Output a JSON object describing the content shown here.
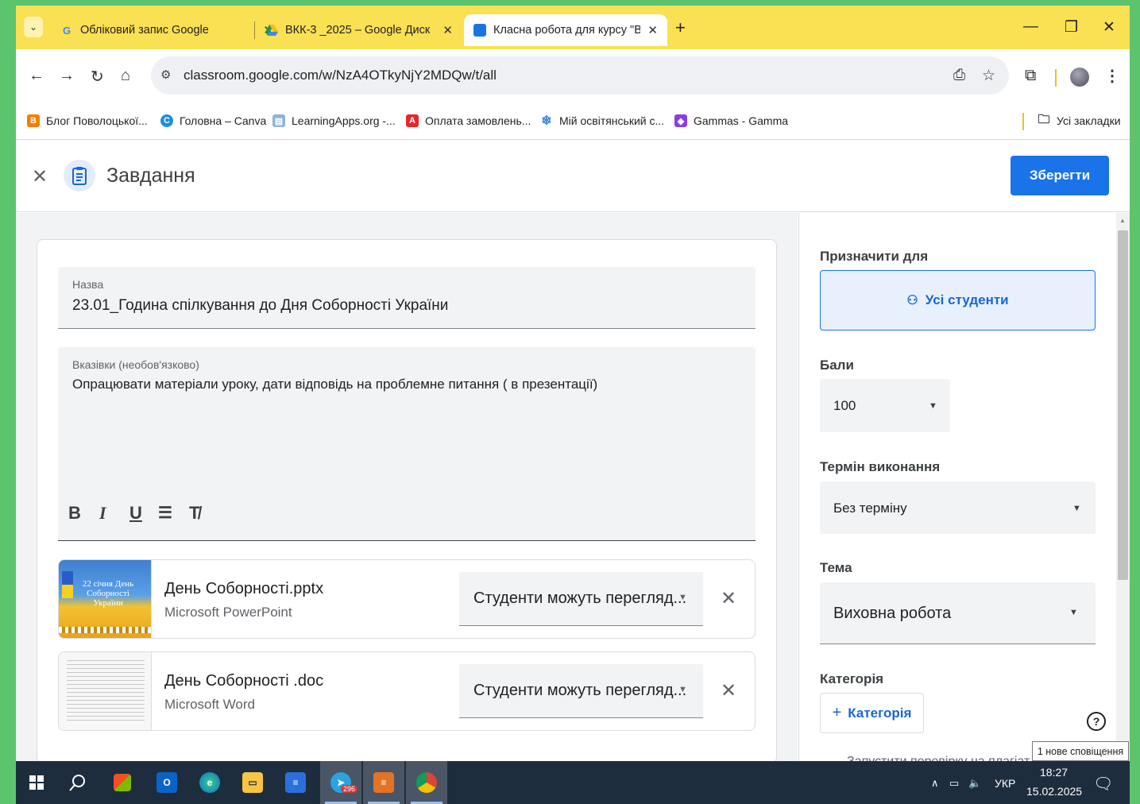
{
  "browser": {
    "tabs": [
      {
        "title": "Обліковий запис Google"
      },
      {
        "title": "ВКК-3 _2025 – Google Диск"
      },
      {
        "title": "Класна робота для курсу \"ВКК"
      }
    ],
    "url": "classroom.google.com/w/NzA4OTkyNjY2MDQw/t/all"
  },
  "bookmarks": {
    "items": [
      {
        "label": "Блог Поволоцької..."
      },
      {
        "label": "Головна – Canva"
      },
      {
        "label": "LearningApps.org -..."
      },
      {
        "label": "Оплата замовлень..."
      },
      {
        "label": "Мій освітянський с..."
      },
      {
        "label": "Gammas - Gamma"
      }
    ],
    "all_bookmarks": "Усі закладки"
  },
  "assignment": {
    "header_title": "Завдання",
    "save_label": "Зберегти",
    "title_label": "Назва",
    "title_value": "23.01_Година спілкування до Дня Соборності України",
    "desc_label": "Вказівки (необов'язково)",
    "desc_value": "Опрацювати матеріали уроку, дати відповідь на проблемне питання ( в презентації)",
    "format": {
      "bold": "B",
      "italic": "I",
      "underline": "U"
    },
    "attachments": [
      {
        "name": "День Соборності.pptx",
        "type": "Microsoft PowerPoint",
        "permission": "Студенти можуть перегляд...",
        "thumb_text": "22 січня День Соборності України"
      },
      {
        "name": "День Соборності .doc",
        "type": "Microsoft Word",
        "permission": "Студенти можуть перегляд..."
      }
    ]
  },
  "panel": {
    "assign_label": "Призначити для",
    "assign_value": "Усі студенти",
    "points_label": "Бали",
    "points_value": "100",
    "due_label": "Термін виконання",
    "due_value": "Без терміну",
    "topic_label": "Тема",
    "topic_value": "Виховна робота",
    "category_label": "Категорія",
    "category_button": "Категорія",
    "plagiarism_partial": "Запустити перевірку на плагіат"
  },
  "notification_tooltip": "1 нове сповіщення",
  "taskbar": {
    "telegram_badge": "296",
    "lang": "УКР",
    "time": "18:27",
    "date": "15.02.2025"
  },
  "colors": {
    "desktop_bg": "#5cc46d",
    "tabstrip": "#fae053",
    "primary": "#1a73e8",
    "taskbar": "#1e2d3e"
  }
}
